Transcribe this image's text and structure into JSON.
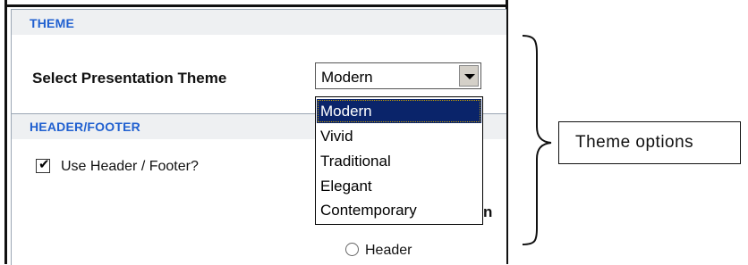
{
  "theme_section": {
    "title": "THEME",
    "select_label": "Select Presentation Theme",
    "selected_value": "Modern",
    "options": [
      "Modern",
      "Vivid",
      "Traditional",
      "Elegant",
      "Contemporary"
    ],
    "highlighted_option": "Modern"
  },
  "header_footer_section": {
    "title": "HEADER/FOOTER",
    "use_header_footer": {
      "label": "Use Header / Footer?",
      "checked": true
    },
    "partial_label": "n",
    "radio_header": {
      "label": "Header",
      "selected": false
    }
  },
  "annotation": {
    "callout_text": "Theme options"
  },
  "colors": {
    "section_title": "#2060d0",
    "selected_item_bg": "#0a246a",
    "section_header_bg": "#eef0f2"
  }
}
